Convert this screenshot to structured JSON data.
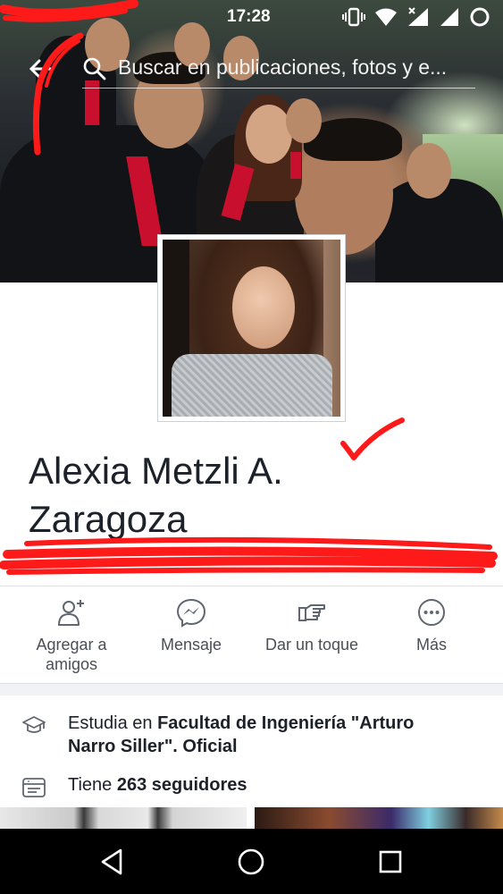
{
  "status_bar": {
    "time": "17:28",
    "icons": [
      "vibrate-icon",
      "wifi-icon",
      "signal-icon",
      "signal-icon",
      "battery-icon"
    ]
  },
  "search": {
    "placeholder": "Buscar en publicaciones, fotos y e..."
  },
  "profile": {
    "name_line1": "Alexia Metzli A.",
    "name_line2": "Zaragoza"
  },
  "actions": [
    {
      "icon": "add-friend-icon",
      "label_line1": "Agregar a",
      "label_line2": "amigos"
    },
    {
      "icon": "messenger-icon",
      "label_line1": "Mensaje",
      "label_line2": ""
    },
    {
      "icon": "poke-icon",
      "label_line1": "Dar un toque",
      "label_line2": ""
    },
    {
      "icon": "more-icon",
      "label_line1": "Más",
      "label_line2": ""
    }
  ],
  "intro": {
    "education_prefix": "Estudia en ",
    "education_school_line1": "Facultad de Ingeniería \"Arturo",
    "education_school_line2": "Narro Siller\". Oficial",
    "followers_prefix": "Tiene ",
    "followers_value": "263 seguidores"
  },
  "navigation": [
    "back-icon",
    "home-icon",
    "recents-icon"
  ],
  "colors": {
    "scribble_red": "#ff1a1a",
    "text_primary": "#1d2129",
    "text_secondary": "#4b4f56",
    "icon_gray": "#606770"
  }
}
